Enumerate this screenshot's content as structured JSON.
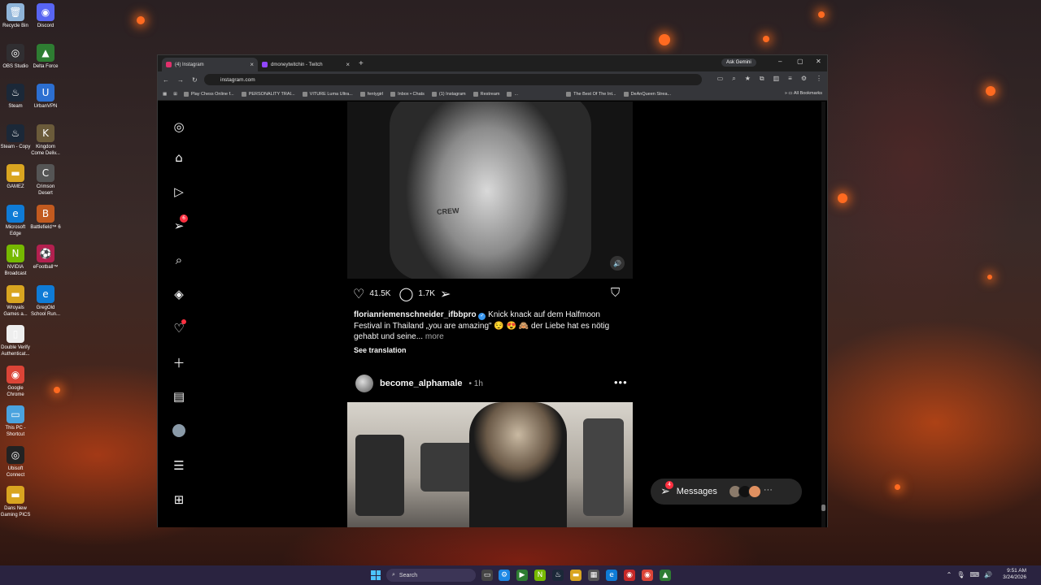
{
  "desktop": {
    "icons": [
      {
        "label": "Recycle Bin",
        "glyph": "🗑",
        "color": "#8fb4d8"
      },
      {
        "label": "Discord",
        "glyph": "◉",
        "color": "#5865f2"
      },
      {
        "label": "OBS Studio",
        "glyph": "◎",
        "color": "#302e31"
      },
      {
        "label": "Delta Force",
        "glyph": "▲",
        "color": "#2e7d32"
      },
      {
        "label": "Steam",
        "glyph": "♨",
        "color": "#1b2838"
      },
      {
        "label": "UrbanVPN",
        "glyph": "U",
        "color": "#2c6fd1"
      },
      {
        "label": "Steam - Copy",
        "glyph": "♨",
        "color": "#1b2838"
      },
      {
        "label": "Kingdom Come Deliv...",
        "glyph": "K",
        "color": "#6b5b3a"
      },
      {
        "label": "GAMEZ",
        "glyph": "▬",
        "color": "#d9a520"
      },
      {
        "label": "Crimson Desert",
        "glyph": "C",
        "color": "#555"
      },
      {
        "label": "Microsoft Edge",
        "glyph": "e",
        "color": "#0f7bd6"
      },
      {
        "label": "Battlefield™ 6",
        "glyph": "B",
        "color": "#c25a1f"
      },
      {
        "label": "NVIDIA Broadcast",
        "glyph": "N",
        "color": "#76b900"
      },
      {
        "label": "eFootball™",
        "glyph": "⚽",
        "color": "#b3204f"
      },
      {
        "label": "Wroyals Games a...",
        "glyph": "▬",
        "color": "#d9a520"
      },
      {
        "label": "GregOld School Run...",
        "glyph": "e",
        "color": "#0f7bd6"
      },
      {
        "label": "Double Verify Authenticat...",
        "glyph": "▯",
        "color": "#eeeeee"
      },
      {
        "label": "Google Chrome",
        "glyph": "◉",
        "color": "#db4437"
      },
      {
        "label": "This PC - Shortcut",
        "glyph": "▭",
        "color": "#4aa3df"
      },
      {
        "label": "Ubisoft Connect",
        "glyph": "◎",
        "color": "#222"
      },
      {
        "label": "Dans New Gaming PICS",
        "glyph": "▬",
        "color": "#d9a520"
      }
    ]
  },
  "browser": {
    "tabs": [
      {
        "title": "(4) Instagram",
        "fav_color": "#e1306c",
        "active": true
      },
      {
        "title": "dmoneytwitchin - Twitch",
        "fav_color": "#9146ff",
        "active": false
      }
    ],
    "new_tab": "+",
    "ask_gemini": "Ask Gemini",
    "window_controls": {
      "minimize": "–",
      "maximize": "▢",
      "close": "✕"
    },
    "nav": {
      "back": "←",
      "forward": "→",
      "reload": "↻"
    },
    "url": "instagram.com",
    "bookmarks": [
      {
        "label": "Play Chess Online f..."
      },
      {
        "label": "PERSONALITY TRAI..."
      },
      {
        "label": "VITURE Luma Ultra..."
      },
      {
        "label": "fentygirl"
      },
      {
        "label": "Inbox • Chats"
      },
      {
        "label": "(1) Instagram"
      },
      {
        "label": "Restream"
      },
      {
        "label": "..."
      },
      {
        "label": "The Best Of The Int..."
      },
      {
        "label": "DeAnQueen Strea..."
      }
    ],
    "all_bookmarks": "All Bookmarks"
  },
  "instagram": {
    "nav_badges": {
      "messages": "6"
    },
    "post1": {
      "video_text": "CREW",
      "likes": "41.5K",
      "comments": "1.7K",
      "username": "florianriemenschneider_ifbbpro",
      "caption": "Knick knack auf dem Halfmoon Festival in Thailand „you are amazing\" 😌 😍 🙈 der Liebe hat es nötig gehabt und seine...",
      "more": "more",
      "see_translation": "See translation"
    },
    "post2": {
      "username": "become_alphamale",
      "separator": "•",
      "time": "1h"
    },
    "messages": {
      "label": "Messages",
      "badge": "4"
    }
  },
  "taskbar": {
    "search_placeholder": "Search",
    "time": "9:51 AM",
    "date": "3/24/2026"
  }
}
